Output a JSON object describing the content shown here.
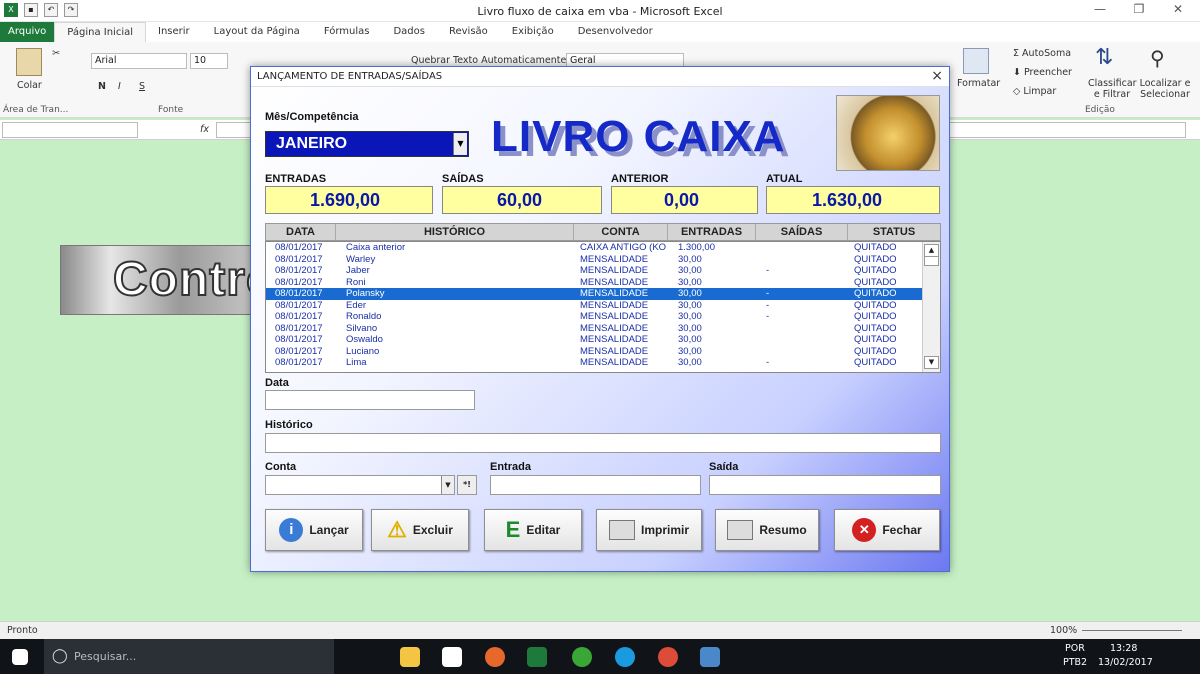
{
  "window": {
    "title": "Livro fluxo de caixa em vba  -  Microsoft Excel"
  },
  "ribbon": {
    "tabs": [
      "Arquivo",
      "Página Inicial",
      "Inserir",
      "Layout da Página",
      "Fórmulas",
      "Dados",
      "Revisão",
      "Exibição",
      "Desenvolvedor"
    ],
    "font_name": "Arial",
    "font_size": "10",
    "wrap_label": "Quebrar Texto Automaticamente",
    "number_format": "Geral",
    "paste_label": "Colar",
    "clipboard_group": "Área de Tran...",
    "font_group": "Fonte",
    "format_label": "Formatar",
    "autosum_label": "AutoSoma",
    "fill_label": "Preencher",
    "clear_label": "Limpar",
    "sort_label": "Classificar e Filtrar",
    "find_label": "Localizar e Selecionar",
    "edit_group": "Edição",
    "bold": "N",
    "italic": "I",
    "underline": "S"
  },
  "formula": {
    "fx": "fx"
  },
  "sheet": {
    "banner_text": "Control"
  },
  "dialog": {
    "title": "LANÇAMENTO DE ENTRADAS/SAÍDAS",
    "close": "×",
    "mes_label": "Mês/Competência",
    "mes_value": "JANEIRO",
    "logo": "LIVRO CAIXA",
    "entradas_label": "ENTRADAS",
    "entradas_value": "1.690,00",
    "saidas_label": "SAÍDAS",
    "saidas_value": "60,00",
    "anterior_label": "ANTERIOR",
    "anterior_value": "0,00",
    "atual_label": "ATUAL",
    "atual_value": "1.630,00",
    "columns": [
      "DATA",
      "HISTÓRICO",
      "CONTA",
      "ENTRADAS",
      "SAÍDAS",
      "STATUS"
    ],
    "rows": [
      {
        "data": "08/01/2017",
        "historico": "Caixa anterior",
        "conta": "CAIXA ANTIGO (KO\\",
        "entradas": "1.300,00",
        "saidas": "",
        "status": "QUITADO"
      },
      {
        "data": "08/01/2017",
        "historico": "Warley",
        "conta": "MENSALIDADE",
        "entradas": "30,00",
        "saidas": "",
        "status": "QUITADO"
      },
      {
        "data": "08/01/2017",
        "historico": "Jaber",
        "conta": "MENSALIDADE",
        "entradas": "30,00",
        "saidas": "-",
        "status": "QUITADO"
      },
      {
        "data": "08/01/2017",
        "historico": "Roni",
        "conta": "MENSALIDADE",
        "entradas": "30,00",
        "saidas": "",
        "status": "QUITADO"
      },
      {
        "data": "08/01/2017",
        "historico": "Polansky",
        "conta": "MENSALIDADE",
        "entradas": "30,00",
        "saidas": "-",
        "status": "QUITADO"
      },
      {
        "data": "08/01/2017",
        "historico": "Eder",
        "conta": "MENSALIDADE",
        "entradas": "30,00",
        "saidas": "-",
        "status": "QUITADO"
      },
      {
        "data": "08/01/2017",
        "historico": "Ronaldo",
        "conta": "MENSALIDADE",
        "entradas": "30,00",
        "saidas": "-",
        "status": "QUITADO"
      },
      {
        "data": "08/01/2017",
        "historico": "Silvano",
        "conta": "MENSALIDADE",
        "entradas": "30,00",
        "saidas": "",
        "status": "QUITADO"
      },
      {
        "data": "08/01/2017",
        "historico": "Oswaldo",
        "conta": "MENSALIDADE",
        "entradas": "30,00",
        "saidas": "",
        "status": "QUITADO"
      },
      {
        "data": "08/01/2017",
        "historico": "Luciano",
        "conta": "MENSALIDADE",
        "entradas": "30,00",
        "saidas": "",
        "status": "QUITADO"
      },
      {
        "data": "08/01/2017",
        "historico": "Lima",
        "conta": "MENSALIDADE",
        "entradas": "30,00",
        "saidas": "-",
        "status": "QUITADO"
      }
    ],
    "data_label": "Data",
    "historico_label": "Histórico",
    "conta_label": "Conta",
    "conta_extra": "*!",
    "entrada_label": "Entrada",
    "saida_label": "Saída",
    "buttons": {
      "lancar": "Lançar",
      "excluir": "Excluir",
      "editar": "Editar",
      "imprimir": "Imprimir",
      "resumo": "Resumo",
      "fechar": "Fechar"
    }
  },
  "status": {
    "ready": "Pronto",
    "zoom": "100%"
  },
  "taskbar": {
    "search": "Pesquisar...",
    "lang": "POR",
    "layout": "PTB2",
    "time": "13:28",
    "date": "13/02/2017"
  }
}
